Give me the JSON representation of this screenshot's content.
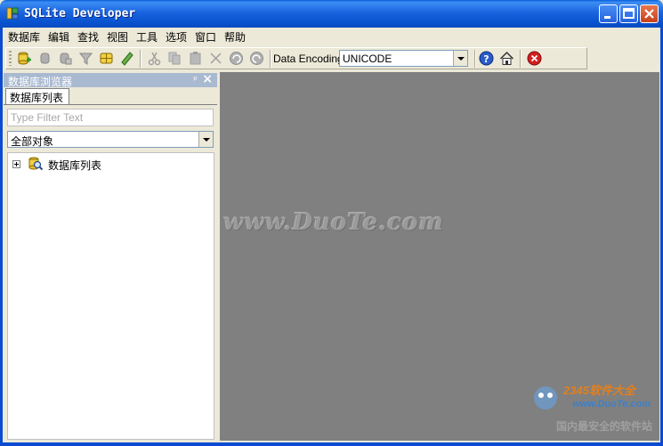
{
  "window": {
    "title": "SQLite Developer",
    "controls": [
      "minimize-icon",
      "maximize-icon",
      "close-icon"
    ]
  },
  "menu": {
    "items": [
      "数据库",
      "编辑",
      "查找",
      "视图",
      "工具",
      "选项",
      "窗口",
      "帮助"
    ]
  },
  "toolbar": {
    "icons": [
      "new-database-icon",
      "open-icon",
      "copy-db-icon",
      "filter-icon",
      "db-objects-icon",
      "ruler-icon",
      "cut-icon",
      "copy-icon",
      "paste-icon",
      "delete-icon",
      "undo-icon",
      "redo-icon",
      "help-icon",
      "home-icon",
      "stop-icon"
    ],
    "encoding_label": "Data Encoding:",
    "encoding_value": "UNICODE"
  },
  "panel": {
    "title": "数据库浏览器",
    "tab_label": "数据库列表",
    "filter_placeholder": "Type Filter Text",
    "object_filter_value": "全部对象",
    "tree": [
      {
        "label": "数据库列表",
        "icon": "database-search-icon",
        "expanded": false
      }
    ]
  },
  "workspace": {
    "watermark": "www.DuoTe.com",
    "corner_brand": "2345软件大全",
    "corner_url": "www.DuoTe.com",
    "corner_slogan": "国内最安全的软件站"
  },
  "colors": {
    "titlebar": "#0a5fd8",
    "workspace": "#808080",
    "panel_header": "#a9b9d0"
  }
}
